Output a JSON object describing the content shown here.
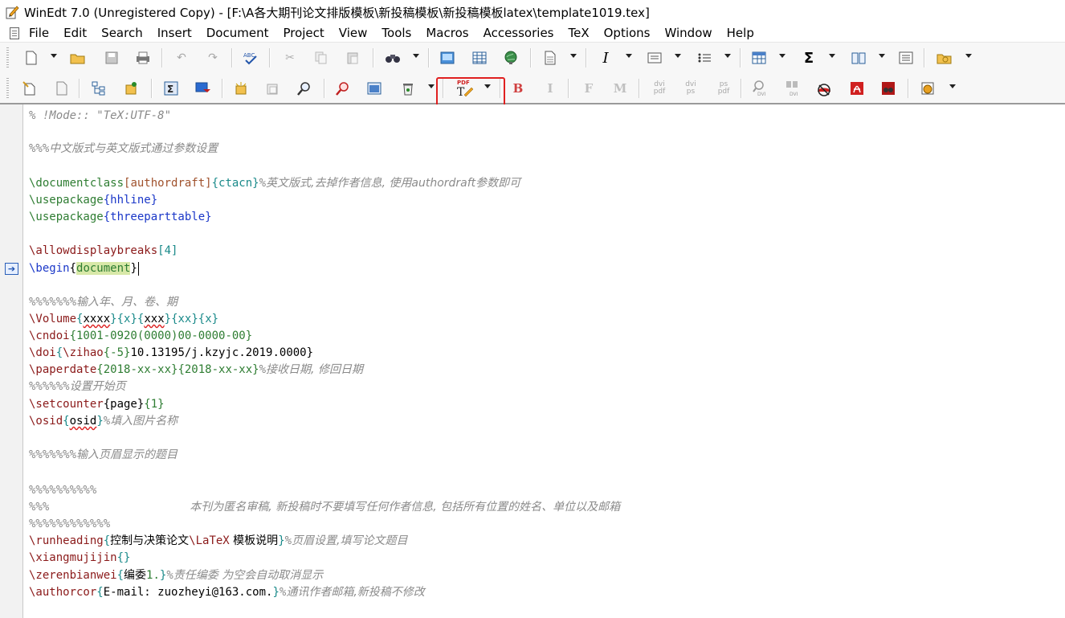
{
  "window": {
    "title": "WinEdt 7.0 (Unregistered  Copy) - [F:\\A各大期刊论文排版模板\\新投稿模板\\新投稿模板latex\\template1019.tex]"
  },
  "menu": [
    {
      "label": "File"
    },
    {
      "label": "Edit"
    },
    {
      "label": "Search"
    },
    {
      "label": "Insert"
    },
    {
      "label": "Document"
    },
    {
      "label": "Project"
    },
    {
      "label": "View"
    },
    {
      "label": "Tools"
    },
    {
      "label": "Macros"
    },
    {
      "label": "Accessories"
    },
    {
      "label": "TeX"
    },
    {
      "label": "Options"
    },
    {
      "label": "Window"
    },
    {
      "label": "Help"
    }
  ],
  "toolbar2_text": {
    "bold": "B",
    "italic": "I",
    "f": "F",
    "m": "M",
    "dvipdf": "dvi\npdf",
    "dvips": "dvi\nps",
    "pspdf": "ps\npdf",
    "pdf_badge": "PDF",
    "dvi_small": "DVI",
    "dvi_small2": "DVI"
  },
  "colors": {
    "highlight_box": "#e02020",
    "current_line": "#fcd3ad",
    "command": "#8b1a1a",
    "keyword_blue": "#1a37c8",
    "argument": "#1a8a8a",
    "comment": "#8a8a8a"
  },
  "editor": {
    "l1": "% !Mode:: \"TeX:UTF-8\"",
    "l2_pct": "%%%",
    "l2_text": "中文版式与英文版式通过参数设置",
    "l3_cmd": "\\documentclass",
    "l3_opt": "[authordraft]",
    "l3_arg": "{ctacn}",
    "l3_pct": "%",
    "l3_cmt": "英文版式,去掉作者信息, 使用authordraft参数即可",
    "l4_cmd": "\\usepackage",
    "l4_arg": "{hhline}",
    "l5_cmd": "\\usepackage",
    "l5_arg": "{threeparttable}",
    "l6_cmd": "\\allowdisplaybreaks",
    "l6_arg": "[4]",
    "l7_cmd": "\\begin",
    "l7_open": "{",
    "l7_arg": "document",
    "l7_close": "}",
    "l8_pct": "%%%%%%%",
    "l8_cmt": "输入年、月、卷、期",
    "l9_cmd": "\\Volume",
    "l9_a1o": "{",
    "l9_a1": "xxxx",
    "l9_a1c": "}",
    "l9_a2": "{x}",
    "l9_a3o": "{",
    "l9_a3": "xxx",
    "l9_a3c": "}",
    "l9_a4": "{xx}",
    "l9_a5": "{x}",
    "l10_cmd": "\\cndoi",
    "l10_arg": "{1001-0920(0000)00-0000-00}",
    "l11_cmd": "\\doi",
    "l11_open": "{",
    "l11_cmd2": "\\zihao",
    "l11_arg2": "{-5}",
    "l11_rest": "10.13195/j.kzyjc.2019.0000}",
    "l12_cmd": "\\paperdate",
    "l12_a1": "{2018-xx-xx}",
    "l12_a2": "{2018-xx-xx}",
    "l12_pct": "%",
    "l12_cmt": "接收日期, 修回日期",
    "l13_pct": "%%%%%%",
    "l13_cmt": "设置开始页",
    "l14_cmd": "\\setcounter",
    "l14_a1": "{page}",
    "l14_a2": "{1}",
    "l15_cmd": "\\osid",
    "l15_o": "{",
    "l15_a": "osid",
    "l15_c": "}",
    "l15_pct": "%",
    "l15_cmt": "填入图片名称",
    "l16_pct": "%%%%%%%",
    "l16_cmt": "输入页眉显示的题目",
    "l17_pct": "%%%%%%%%%%",
    "l18_pct": "%%%",
    "l18_cmt": "本刊为匿名审稿, 新投稿时不要填写任何作者信息, 包括所有位置的姓名、单位以及邮箱",
    "l19_pct": "%%%%%%%%%%%%",
    "l20_cmd": "\\runheading",
    "l20_o": "{",
    "l20_t1": "控制与决策论文",
    "l20_cmd2": "\\LaTeX",
    "l20_t2": " 模板说明",
    "l20_c": "}",
    "l20_pct": "%",
    "l20_cmt": "页眉设置,填写论文题目",
    "l21_cmd": "\\xiangmujijin",
    "l21_arg": "{}",
    "l22_cmd": "\\zerenbianwei",
    "l22_o": "{",
    "l22_t": "编委",
    "l22_n": "1.",
    "l22_c": "}",
    "l22_pct": "%",
    "l22_cmt": "责任编委 为空会自动取消显示",
    "l23_cmd": "\\authorcor",
    "l23_o": "{",
    "l23_t": "E-mail: zuozheyi@163.com.",
    "l23_c": "}",
    "l23_pct": "%",
    "l23_cmt": "通讯作者邮箱,新投稿不修改"
  }
}
